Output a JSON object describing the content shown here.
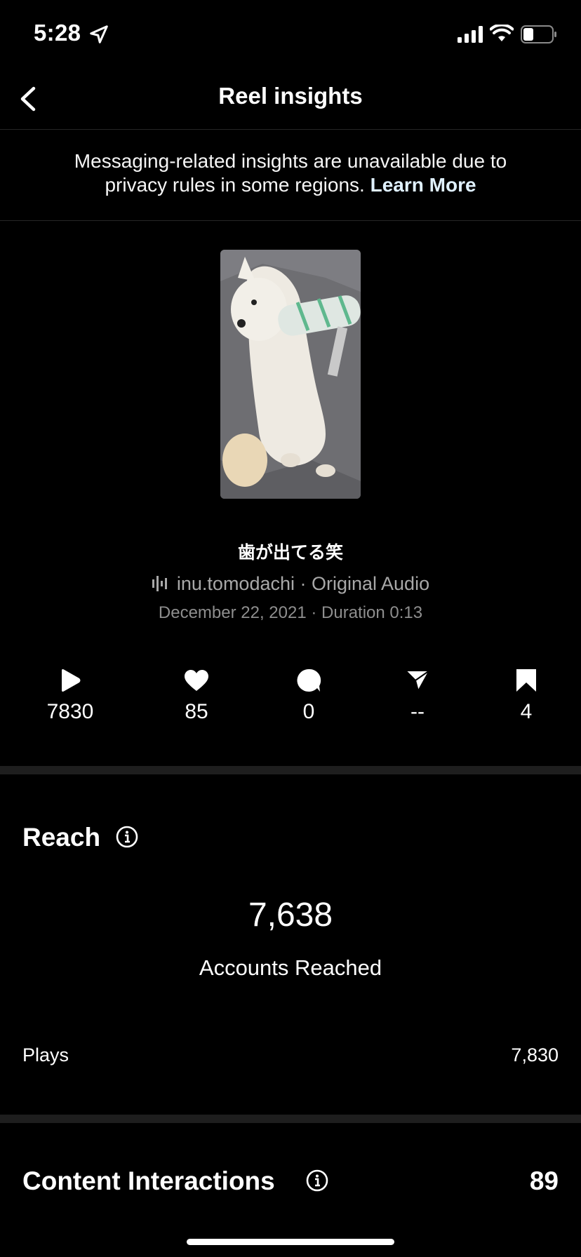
{
  "status_bar": {
    "time": "5:28"
  },
  "header": {
    "title": "Reel insights"
  },
  "notice": {
    "text": "Messaging-related insights are unavailable due to privacy rules in some regions. ",
    "link": "Learn More"
  },
  "reel": {
    "caption": "歯が出てる笑",
    "audio": "inu.tomodachi · Original Audio",
    "meta": "December 22, 2021 · Duration 0:13"
  },
  "stats": [
    {
      "icon": "play-icon",
      "value": "7830"
    },
    {
      "icon": "heart-icon",
      "value": "85"
    },
    {
      "icon": "comment-icon",
      "value": "0"
    },
    {
      "icon": "share-icon",
      "value": "--"
    },
    {
      "icon": "save-icon",
      "value": "4"
    }
  ],
  "reach": {
    "title": "Reach",
    "value": "7,638",
    "label": "Accounts Reached",
    "plays_label": "Plays",
    "plays_value": "7,830"
  },
  "interactions": {
    "title": "Content Interactions",
    "value": "89"
  }
}
